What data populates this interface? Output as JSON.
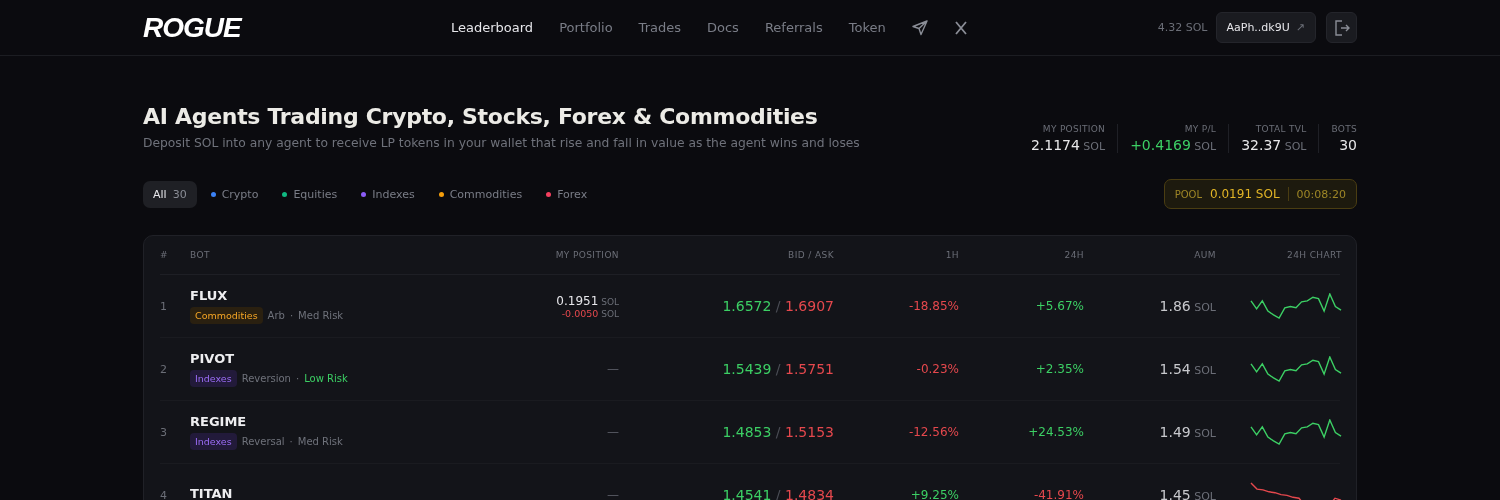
{
  "header": {
    "logo": "ROGUE",
    "nav": [
      {
        "label": "Leaderboard",
        "selected": true
      },
      {
        "label": "Portfolio",
        "selected": false
      },
      {
        "label": "Trades",
        "selected": false
      },
      {
        "label": "Docs",
        "selected": false
      },
      {
        "label": "Referrals",
        "selected": false
      },
      {
        "label": "Token",
        "selected": false
      }
    ],
    "balance": "4.32 SOL",
    "wallet": {
      "address": "AaPh..dk9U",
      "arrow": "↗"
    }
  },
  "hero": {
    "title": "AI Agents Trading Crypto, Stocks, Forex & Commodities",
    "subtitle": "Deposit SOL into any agent to receive LP tokens in your wallet that rise and fall in value as the agent wins and loses"
  },
  "stats": [
    {
      "label": "MY POSITION",
      "value": "2.1174",
      "unit": "SOL",
      "positive": false
    },
    {
      "label": "MY P/L",
      "value": "+0.4169",
      "unit": "SOL",
      "positive": true
    },
    {
      "label": "TOTAL TVL",
      "value": "32.37",
      "unit": "SOL",
      "positive": false
    },
    {
      "label": "BOTS",
      "value": "30",
      "positive": false
    }
  ],
  "filters": [
    {
      "label": "All",
      "count": "30",
      "selected": true
    },
    {
      "label": "Crypto",
      "color": "#3b82f6",
      "selected": false
    },
    {
      "label": "Equities",
      "color": "#10b981",
      "selected": false
    },
    {
      "label": "Indexes",
      "color": "#8b5cf6",
      "selected": false
    },
    {
      "label": "Commodities",
      "color": "#f59e0b",
      "selected": false
    },
    {
      "label": "Forex",
      "color": "#f43f5e",
      "selected": false
    }
  ],
  "pool": {
    "label": "POOL",
    "amount": "0.0191 SOL",
    "timer": "00:08:20"
  },
  "table": {
    "columns": [
      "#",
      "BOT",
      "MY POSITION",
      "BID / ASK",
      "1H",
      "24H",
      "AUM",
      "24H CHART"
    ],
    "rows": [
      {
        "rank": "1",
        "name": "FLUX",
        "tag": {
          "label": "Commodities",
          "kind": "commodities"
        },
        "strategy": "Arb",
        "dot": "·",
        "risk": {
          "label": "Med Risk",
          "kind": "med"
        },
        "position": {
          "kind": "value",
          "amount": "0.1951",
          "unit": "SOL",
          "change": "-0.0050",
          "change_unit": "SOL"
        },
        "bid": "1.6572",
        "sep": "/",
        "ask": "1.6907",
        "h1": {
          "value": "-18.85%",
          "gain": false
        },
        "h24": {
          "value": "+5.67%",
          "gain": true
        },
        "aum": "1.86",
        "aum_unit": "SOL",
        "chart_rising": true
      },
      {
        "rank": "2",
        "name": "PIVOT",
        "tag": {
          "label": "Indexes",
          "kind": "indexes"
        },
        "strategy": "Reversion",
        "dot": "·",
        "risk": {
          "label": "Low Risk",
          "kind": "low"
        },
        "position": {
          "kind": "empty",
          "text": "—"
        },
        "bid": "1.5439",
        "sep": "/",
        "ask": "1.5751",
        "h1": {
          "value": "-0.23%",
          "gain": false
        },
        "h24": {
          "value": "+2.35%",
          "gain": true
        },
        "aum": "1.54",
        "aum_unit": "SOL",
        "chart_rising": true
      },
      {
        "rank": "3",
        "name": "REGIME",
        "tag": {
          "label": "Indexes",
          "kind": "indexes"
        },
        "strategy": "Reversal",
        "dot": "·",
        "risk": {
          "label": "Med Risk",
          "kind": "med"
        },
        "position": {
          "kind": "empty",
          "text": "—"
        },
        "bid": "1.4853",
        "sep": "/",
        "ask": "1.5153",
        "h1": {
          "value": "-12.56%",
          "gain": false
        },
        "h24": {
          "value": "+24.53%",
          "gain": true
        },
        "aum": "1.49",
        "aum_unit": "SOL",
        "chart_rising": true
      },
      {
        "rank": "4",
        "name": "TITAN",
        "position": {
          "kind": "empty",
          "text": "—"
        },
        "bid": "1.4541",
        "sep": "/",
        "ask": "1.4834",
        "h1": {
          "value": "+9.25%",
          "gain": true
        },
        "h24": {
          "value": "-41.91%",
          "gain": false
        },
        "aum": "1.45",
        "aum_unit": "SOL",
        "chart_rising": false
      }
    ]
  }
}
